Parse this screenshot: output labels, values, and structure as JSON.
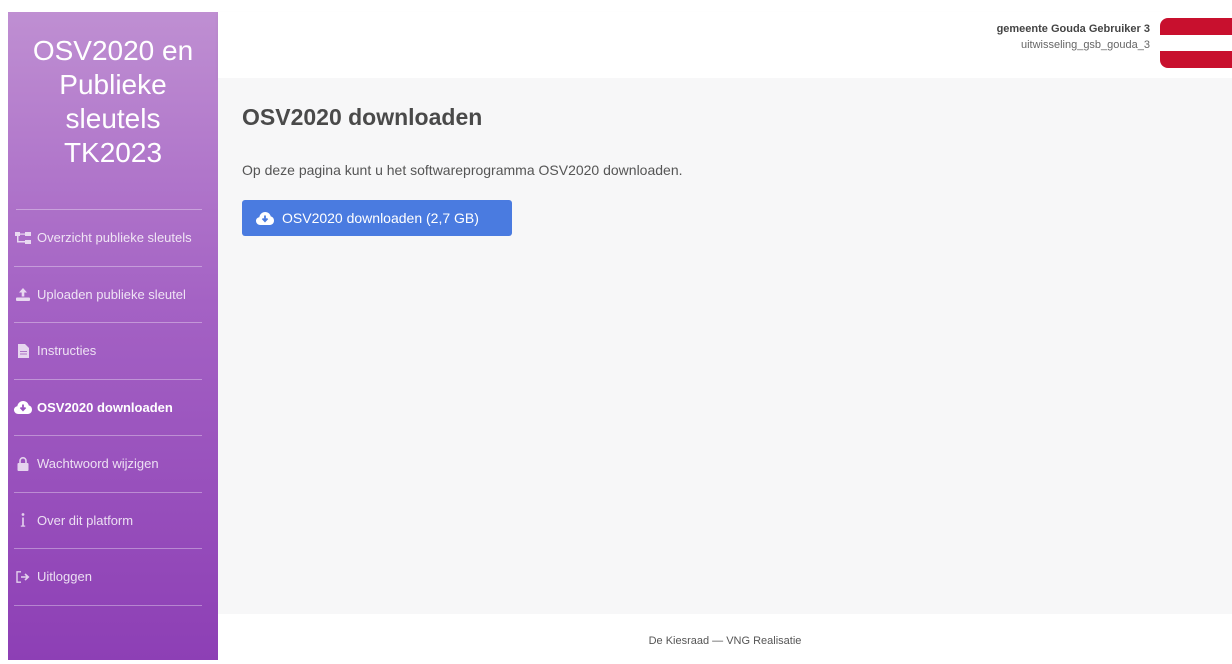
{
  "sidebar": {
    "brand": "OSV2020 en Publieke sleutels TK2023",
    "items": [
      {
        "label": "Overzicht publieke sleutels",
        "icon": "sitemap-icon"
      },
      {
        "label": "Uploaden publieke sleutel",
        "icon": "upload-icon"
      },
      {
        "label": "Instructies",
        "icon": "document-icon"
      },
      {
        "label": "OSV2020 downloaden",
        "icon": "cloud-download-icon",
        "active": true
      },
      {
        "label": "Wachtwoord wijzigen",
        "icon": "lock-icon"
      },
      {
        "label": "Over dit platform",
        "icon": "info-icon"
      },
      {
        "label": "Uitloggen",
        "icon": "sign-out-icon"
      }
    ]
  },
  "header": {
    "user_name": "gemeente Gouda Gebruiker 3",
    "user_sub": "uitwisseling_gsb_gouda_3",
    "flag_colors": [
      "#c8102e",
      "#ffffff",
      "#c8102e"
    ]
  },
  "main": {
    "title": "OSV2020 downloaden",
    "intro": "Op deze pagina kunt u het softwareprogramma OSV2020 downloaden.",
    "download_label": "OSV2020 downloaden (2,7 GB)"
  },
  "footer": {
    "text": "De Kiesraad — VNG Realisatie"
  },
  "colors": {
    "sidebar_top": "#bf8fd2",
    "sidebar_bottom": "#8d3fb5",
    "button": "#4a7be0",
    "main_bg": "#f7f7f8"
  }
}
